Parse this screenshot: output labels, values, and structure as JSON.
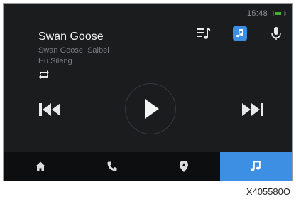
{
  "status": {
    "time": "15:48",
    "battery_color": "#43b12c",
    "battery_level": 0.8
  },
  "track": {
    "title": "Swan Goose",
    "artist_line": "Swan Goose, Saibei",
    "artist_line2": "Hu Sileng"
  },
  "icons": {
    "repeat": "repeat-icon",
    "playlist": "playlist-icon",
    "source": "music-source-icon",
    "voice": "microphone-icon",
    "previous": "skip-previous-icon",
    "play": "play-icon",
    "next": "skip-next-icon"
  },
  "nav": {
    "items": [
      {
        "icon": "home-icon",
        "active": false
      },
      {
        "icon": "phone-icon",
        "active": false
      },
      {
        "icon": "navigation-icon",
        "active": false
      },
      {
        "icon": "music-icon",
        "active": true
      }
    ]
  },
  "colors": {
    "accent": "#3c8fe3",
    "screen_bg": "#1b1c1e",
    "bar_bg": "#0d0e0f"
  },
  "figure_code": "X405580O"
}
